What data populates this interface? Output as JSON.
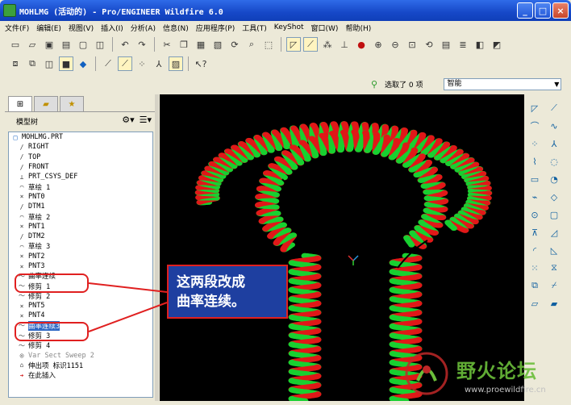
{
  "window": {
    "title": "MOHLMG (活动的) - Pro/ENGINEER Wildfire 6.0",
    "min_glyph": "_",
    "max_glyph": "□",
    "close_glyph": "×"
  },
  "menu": [
    "文件(F)",
    "编辑(E)",
    "视图(V)",
    "插入(I)",
    "分析(A)",
    "信息(N)",
    "应用程序(P)",
    "工具(T)",
    "KeyShot",
    "窗口(W)",
    "帮助(H)"
  ],
  "filter": {
    "status": "选取了 0 项",
    "value": "智能"
  },
  "nav_tabs": [
    "model-tree",
    "folder",
    "favorites"
  ],
  "tree": {
    "title": "模型树",
    "items": [
      {
        "label": "MOHLMG.PRT",
        "icon": "□",
        "kind": "root"
      },
      {
        "label": "RIGHT",
        "icon": "∕",
        "kind": "indent"
      },
      {
        "label": "TOP",
        "icon": "∕",
        "kind": "indent"
      },
      {
        "label": "FRONT",
        "icon": "∕",
        "kind": "indent"
      },
      {
        "label": "PRT_CSYS_DEF",
        "icon": "⊥",
        "kind": "indent"
      },
      {
        "label": "草绘 1",
        "icon": "⌒",
        "kind": "indent"
      },
      {
        "label": "PNT0",
        "icon": "×",
        "kind": "indent"
      },
      {
        "label": "DTM1",
        "icon": "∕",
        "kind": "indent"
      },
      {
        "label": "草绘 2",
        "icon": "⌒",
        "kind": "indent"
      },
      {
        "label": "PNT1",
        "icon": "×",
        "kind": "indent"
      },
      {
        "label": "DTM2",
        "icon": "∕",
        "kind": "indent"
      },
      {
        "label": "草绘 3",
        "icon": "⌒",
        "kind": "indent"
      },
      {
        "label": "PNT2",
        "icon": "×",
        "kind": "indent"
      },
      {
        "label": "PNT3",
        "icon": "×",
        "kind": "indent"
      },
      {
        "label": "曲率连续",
        "icon": "～",
        "kind": "indent"
      },
      {
        "label": "修剪 1",
        "icon": "～",
        "kind": "indent"
      },
      {
        "label": "修剪 2",
        "icon": "～",
        "kind": "indent"
      },
      {
        "label": "PNT5",
        "icon": "×",
        "kind": "indent"
      },
      {
        "label": "PNT4",
        "icon": "×",
        "kind": "indent"
      },
      {
        "label": "曲率连续3",
        "icon": "～",
        "kind": "indent",
        "selected": true
      },
      {
        "label": "修剪 3",
        "icon": "～",
        "kind": "indent"
      },
      {
        "label": "修剪 4",
        "icon": "～",
        "kind": "indent"
      },
      {
        "label": "Var Sect Sweep 2",
        "icon": "◎",
        "kind": "indent",
        "grey": true
      },
      {
        "label": "伸出项 标识1151",
        "icon": "⌂",
        "kind": "indent"
      },
      {
        "label": "在此插入",
        "icon": "➔",
        "kind": "indent",
        "red": true
      }
    ]
  },
  "annotation": {
    "line1": "这两段改成",
    "line2": "曲率连续。"
  },
  "watermark": {
    "name": "野火论坛",
    "url": "www.proewildfire.cn"
  },
  "colors": {
    "spring_red": "#E01818",
    "spring_green": "#18D030",
    "annotation_bg": "#1E3FA0",
    "annotation_border": "#E02020"
  }
}
